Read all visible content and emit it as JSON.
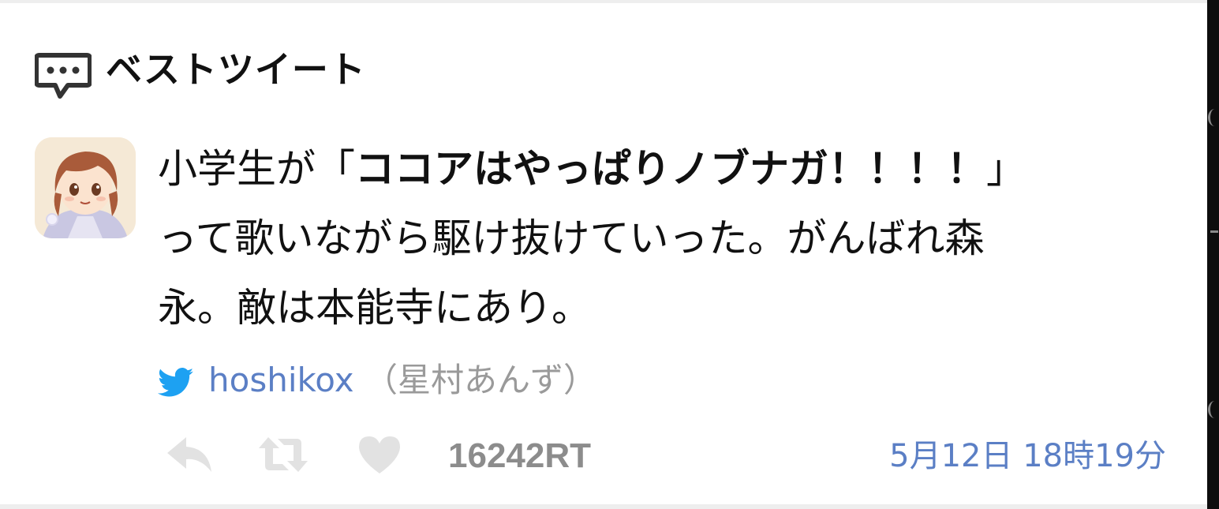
{
  "header": {
    "title": "ベストツイート",
    "icon": "speech-bubble-icon"
  },
  "tweet": {
    "avatar": "avatar",
    "text_prefix": "小学生が「",
    "text_bold": "ココアはやっぱりノブナガ！！！！",
    "text_suffix": "」",
    "line2": "って歌いながら駆け抜けていった。がんばれ森",
    "line3": "永。敵は本能寺にあり。"
  },
  "author": {
    "icon": "twitter-bird-icon",
    "handle": "hoshikox",
    "name": "（星村あんず）"
  },
  "actions": {
    "reply_icon": "reply-icon",
    "retweet_icon": "retweet-icon",
    "like_icon": "heart-icon",
    "retweet_count": "16242RT",
    "timestamp": "5月12日 18時19分"
  },
  "colors": {
    "link": "#5b7fc5",
    "muted": "#9a9a9a",
    "icon_muted": "#e2e2e2",
    "twitter_blue": "#1da1f2"
  }
}
